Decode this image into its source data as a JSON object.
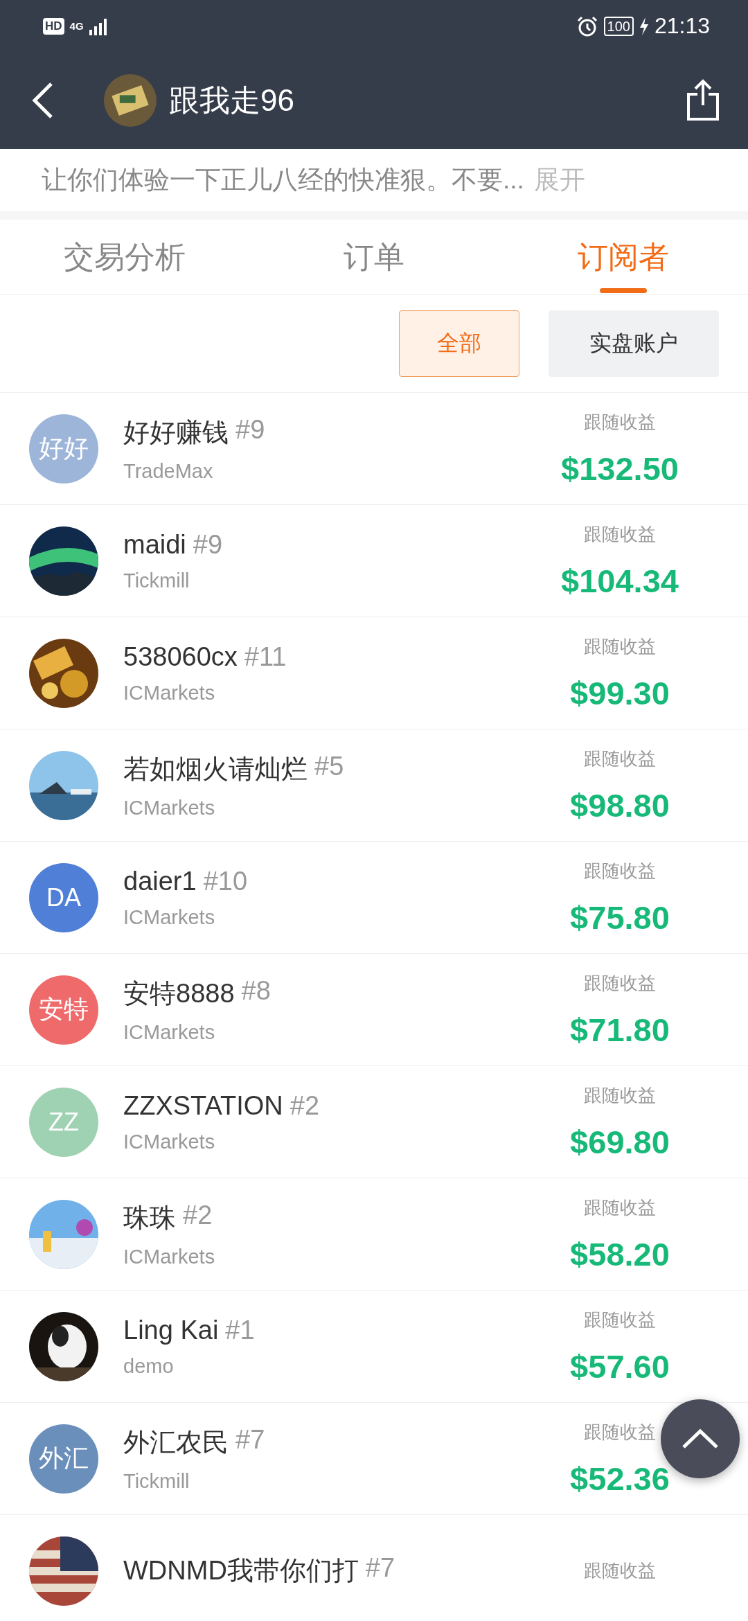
{
  "status_bar": {
    "hd": "HD",
    "network": "4G",
    "battery": "100",
    "time": "21:13"
  },
  "header": {
    "title": "跟我走96"
  },
  "description": {
    "text": "让你们体验一下正儿八经的快准狠。不要...",
    "more": "展开"
  },
  "tabs": [
    {
      "label": "交易分析",
      "selected": false
    },
    {
      "label": "订单",
      "selected": false
    },
    {
      "label": "订阅者",
      "selected": true
    }
  ],
  "filters": [
    {
      "label": "全部",
      "selected": true
    },
    {
      "label": "实盘账户",
      "selected": false
    }
  ],
  "subscribers": [
    {
      "name": "好好赚钱",
      "rank": "#9",
      "broker": "TradeMax",
      "label": "跟随收益",
      "amount": "$132.50",
      "avatar": {
        "kind": "text",
        "text": "好好",
        "color": "#9db5d8"
      }
    },
    {
      "name": "maidi",
      "rank": "#9",
      "broker": "Tickmill",
      "label": "跟随收益",
      "amount": "$104.34"
    },
    {
      "name": "538060cx",
      "rank": "#11",
      "broker": "ICMarkets",
      "label": "跟随收益",
      "amount": "$99.30"
    },
    {
      "name": "若如烟火请灿烂",
      "rank": "#5",
      "broker": "ICMarkets",
      "label": "跟随收益",
      "amount": "$98.80"
    },
    {
      "name": "daier1",
      "rank": "#10",
      "broker": "ICMarkets",
      "label": "跟随收益",
      "amount": "$75.80",
      "avatar": {
        "kind": "text",
        "text": "DA",
        "color": "#4f7fd6"
      }
    },
    {
      "name": "安特8888",
      "rank": "#8",
      "broker": "ICMarkets",
      "label": "跟随收益",
      "amount": "$71.80",
      "avatar": {
        "kind": "text",
        "text": "安特",
        "color": "#ef6b6b"
      }
    },
    {
      "name": "ZZXSTATION",
      "rank": "#2",
      "broker": "ICMarkets",
      "label": "跟随收益",
      "amount": "$69.80",
      "avatar": {
        "kind": "text",
        "text": "ZZ",
        "color": "#9ed2b2"
      }
    },
    {
      "name": "珠珠",
      "rank": "#2",
      "broker": "ICMarkets",
      "label": "跟随收益",
      "amount": "$58.20"
    },
    {
      "name": "Ling Kai",
      "rank": "#1",
      "broker": "demo",
      "label": "跟随收益",
      "amount": "$57.60"
    },
    {
      "name": "外汇农民",
      "rank": "#7",
      "broker": "Tickmill",
      "label": "跟随收益",
      "amount": "$52.36",
      "avatar": {
        "kind": "text",
        "text": "外汇",
        "color": "#6a8fbb"
      }
    },
    {
      "name": "WDNMD我带你们打",
      "rank": "#7",
      "label": "跟随收益"
    }
  ]
}
